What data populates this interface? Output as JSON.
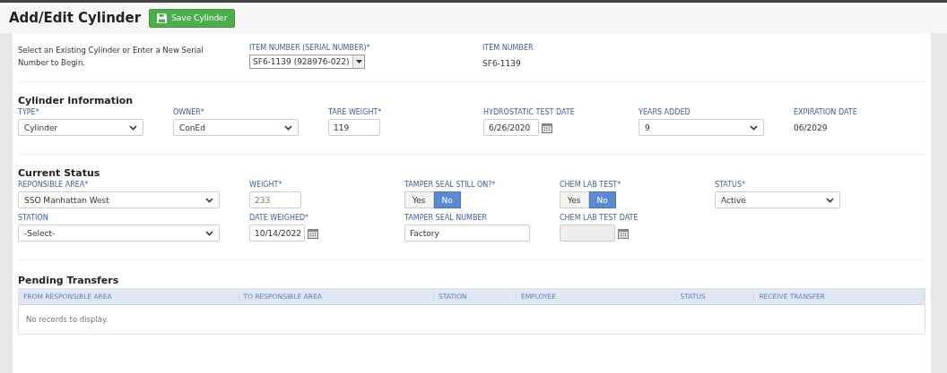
{
  "header": {
    "title": "Add/Edit Cylinder",
    "save_button": "Save Cylinder"
  },
  "intro": {
    "text": "Select an Existing Cylinder or Enter a New Serial Number to Begin.",
    "item_select": {
      "label": "ITEM NUMBER (SERIAL NUMBER)*",
      "value": "SF6-1139  (928976-022)"
    },
    "item_number": {
      "label": "ITEM NUMBER",
      "value": "SF6-1139"
    }
  },
  "sections": [
    {
      "title": "Cylinder Information",
      "rows": [
        [
          {
            "kind": "select",
            "label": "TYPE*",
            "value": "Cylinder"
          },
          {
            "kind": "select",
            "label": "OWNER*",
            "value": "ConEd"
          },
          {
            "kind": "input",
            "label": "TARE WEIGHT*",
            "value": "119"
          },
          {
            "kind": "date",
            "label": "HYDROSTATIC TEST DATE",
            "value": "6/26/2020",
            "disabled": false
          },
          {
            "kind": "select",
            "label": "YEARS ADDED",
            "value": "9"
          },
          {
            "kind": "text",
            "label": "EXPIRATION DATE",
            "value": "06/2029"
          }
        ]
      ]
    },
    {
      "title": "Current Status",
      "rows": [
        [
          {
            "kind": "select",
            "label": "REPONSIBLE AREA*",
            "value": "SSO Manhattan West"
          },
          {
            "kind": "input",
            "label": "WEIGHT*",
            "value": "233",
            "readonly": true
          },
          {
            "kind": "toggle",
            "label": "TAMPER SEAL STILL ON?*",
            "options": [
              {
                "label": "Yes",
                "selected": false
              },
              {
                "label": "No",
                "selected": true
              }
            ]
          },
          {
            "kind": "toggle",
            "label": "CHEM LAB TEST*",
            "options": [
              {
                "label": "Yes",
                "selected": false
              },
              {
                "label": "No",
                "selected": true
              }
            ]
          },
          {
            "kind": "select",
            "label": "STATUS*",
            "value": "Active"
          }
        ],
        [
          {
            "kind": "select",
            "label": "STATION",
            "value": "-Select-"
          },
          {
            "kind": "date",
            "label": "DATE WEIGHED*",
            "value": "10/14/2022",
            "disabled": false
          },
          {
            "kind": "input",
            "label": "TAMPER SEAL NUMBER",
            "value": "Factory"
          },
          {
            "kind": "date",
            "label": "CHEM LAB TEST DATE",
            "disabled": true
          }
        ]
      ]
    }
  ],
  "pending_transfers": {
    "title": "Pending Transfers",
    "columns": [
      "FROM RESPONSIBLE AREA",
      "TO RESPONSIBLE AREA",
      "STATION",
      "EMPLOYEE",
      "STATUS",
      "RECEIVE TRANSFER"
    ],
    "empty_message": "No records to display."
  }
}
